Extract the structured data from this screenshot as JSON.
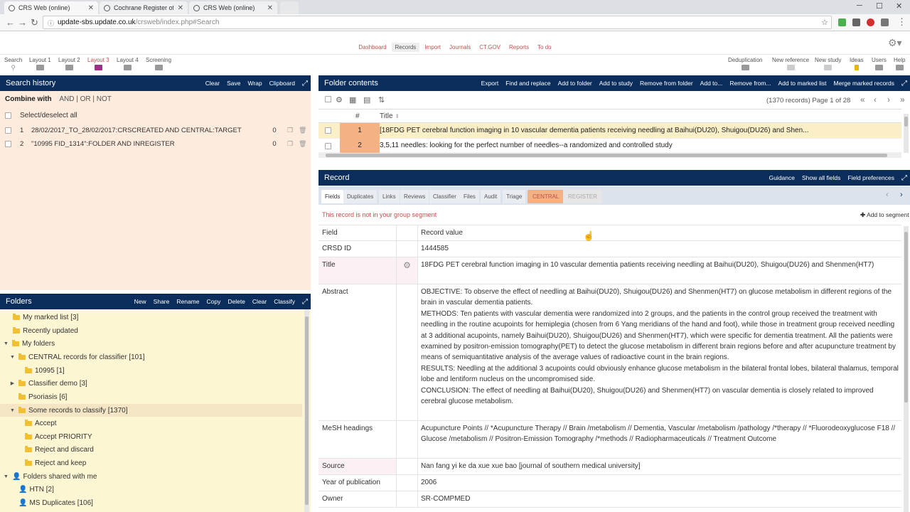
{
  "browser": {
    "tabs": [
      {
        "title": "CRS Web (online)",
        "active": true
      },
      {
        "title": "Cochrane Register of St...",
        "active": false
      },
      {
        "title": "CRS Web (online)",
        "active": false
      }
    ],
    "url_domain": "update-sbs.update.co.uk",
    "url_path": "/crsweb/index.php#Search"
  },
  "topnav": [
    "Dashboard",
    "Records",
    "Import",
    "Journals",
    "CT.GOV",
    "Reports",
    "To do"
  ],
  "toolbar_left": [
    "Search",
    "Layout 1",
    "Layout 2",
    "Layout 3",
    "Layout 4",
    "Screening"
  ],
  "toolbar_right": [
    "Deduplication",
    "New reference",
    "New study",
    "Ideas",
    "Users",
    "Help"
  ],
  "search_history": {
    "title": "Search history",
    "actions": [
      "Clear",
      "Save",
      "Wrap",
      "Clipboard"
    ],
    "combine_label": "Combine with",
    "combine_ops": "AND | OR | NOT",
    "select_all": "Select/deselect all",
    "rows": [
      {
        "num": "1",
        "query": "28/02/2017_TO_28/02/2017:CRSCREATED AND CENTRAL:TARGET",
        "count": "0"
      },
      {
        "num": "2",
        "query": "\"10995 FID_1314\":FOLDER AND INREGISTER",
        "count": "0"
      }
    ]
  },
  "folders": {
    "title": "Folders",
    "actions": [
      "New",
      "Share",
      "Rename",
      "Copy",
      "Delete",
      "Clear",
      "Classify"
    ],
    "items": [
      {
        "label": "My marked list [3]"
      },
      {
        "label": "Recently updated"
      },
      {
        "label": "My folders"
      },
      {
        "label": "CENTRAL records for classifier [101]"
      },
      {
        "label": "10995 [1]"
      },
      {
        "label": "Classifier demo [3]"
      },
      {
        "label": "Psoriasis [6]"
      },
      {
        "label": "Some records to classify [1370]"
      },
      {
        "label": "Accept"
      },
      {
        "label": "Accept PRIORITY"
      },
      {
        "label": "Reject and discard"
      },
      {
        "label": "Reject and keep"
      },
      {
        "label": "Folders shared with me"
      },
      {
        "label": "HTN [2]"
      },
      {
        "label": "MS Duplicates [106]"
      }
    ]
  },
  "folder_contents": {
    "title": "Folder contents",
    "actions": [
      "Export",
      "Find and replace",
      "Add to folder",
      "Add to study",
      "Remove from folder",
      "Add to...",
      "Remove from...",
      "Add to marked list",
      "Merge marked records"
    ],
    "record_info": "(1370 records) Page 1 of 28",
    "col_num": "#",
    "col_title": "Title",
    "rows": [
      {
        "num": "1",
        "title": "[18FDG PET cerebral function imaging in 10 vascular dementia patients receiving needling at Baihui(DU20), Shuigou(DU26) and Shen..."
      },
      {
        "num": "2",
        "title": "3,5,11 needles: looking for the perfect number of needles--a randomized and controlled study"
      }
    ]
  },
  "record": {
    "title": "Record",
    "actions": [
      "Guidance",
      "Show all fields",
      "Field preferences"
    ],
    "tabs": [
      "Fields",
      "Duplicates",
      "Links",
      "Reviews",
      "Classifier",
      "Files",
      "Audit",
      "Triage",
      "CENTRAL",
      "REGISTER"
    ],
    "not_in_segment": "This record is not in your group segment",
    "add_segment": "Add to segment",
    "col_field": "Field",
    "col_value": "Record value",
    "crsd_label": "CRSD ID",
    "crsd_value": "1444585",
    "title_label": "Title",
    "title_value": "18FDG PET cerebral function imaging in 10 vascular dementia patients receiving needling at Baihui(DU20), Shuigou(DU26) and Shenmen(HT7)",
    "abstract_label": "Abstract",
    "abstract_lines": [
      "OBJECTIVE: To observe the effect of needling at Baihui(DU20), Shuigou(DU26) and Shenmen(HT7) on glucose metabolism in different regions of the brain in vascular dementia patients.",
      "METHODS: Ten patients with vascular dementia were randomized into 2 groups, and the patients in the control group received the treatment with needling in the routine acupoints for hemiplegia (chosen from 6 Yang meridians of the hand and foot), while those in treatment group received needling at 3 additional acupoints, namely Baihui(DU20), Shuigou(DU26) and Shenmen(HT7), which were specific for dementia treatment. All the patients were examined by positron-emission tomography(PET) to detect the glucose metabolism in different brain regions before and after acupuncture treatment by means of semiquantitative analysis of the average values of radioactive count in the brain regions.",
      "RESULTS: Needling at the additional 3 acupoints could obviously enhance glucose metabolism in the bilateral frontal lobes, bilateral thalamus, temporal lobe and lentiform nucleus on the uncompromised side.",
      "CONCLUSION: The effect of needling at Baihui(DU20), Shuigou(DU26) and Shenmen(HT7) on vascular dementia is closely related to improved cerebral glucose metabolism."
    ],
    "mesh_label": "MeSH headings",
    "mesh_value": "Acupuncture Points // *Acupuncture Therapy // Brain /metabolism // Dementia, Vascular /metabolism /pathology /*therapy // *Fluorodeoxyglucose F18 // Glucose /metabolism // Positron-Emission Tomography /*methods // Radiopharmaceuticals // Treatment Outcome",
    "source_label": "Source",
    "source_value": "Nan fang yi ke da xue xue bao [journal of southern medical university]",
    "year_label": "Year of publication",
    "year_value": "2006",
    "owner_label": "Owner",
    "owner_value": "SR-COMPMED"
  }
}
